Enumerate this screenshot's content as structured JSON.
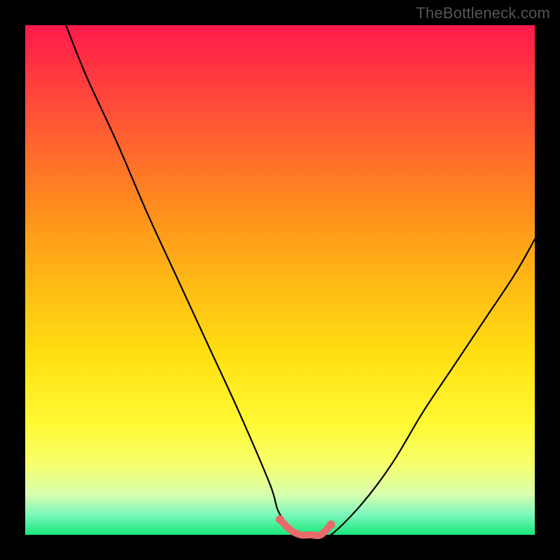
{
  "watermark": "TheBottleneck.com",
  "chart_data": {
    "type": "line",
    "title": "",
    "xlabel": "",
    "ylabel": "",
    "xlim": [
      0,
      100
    ],
    "ylim": [
      0,
      100
    ],
    "grid": false,
    "legend": false,
    "background_gradient": [
      "#ff1a4d",
      "#ffe012",
      "#18e87a"
    ],
    "series": [
      {
        "name": "bottleneck-curve",
        "x": [
          8,
          12,
          18,
          24,
          30,
          36,
          42,
          48,
          50,
          54,
          58,
          60,
          66,
          72,
          78,
          84,
          90,
          96,
          100
        ],
        "y": [
          100,
          90,
          77,
          63,
          50,
          37,
          24,
          10,
          4,
          0,
          0,
          0,
          6,
          14,
          24,
          33,
          42,
          51,
          58
        ]
      },
      {
        "name": "valley-highlight",
        "x": [
          50,
          52,
          54,
          56,
          58,
          60
        ],
        "y": [
          3,
          1,
          0,
          0,
          0,
          2
        ]
      }
    ],
    "annotations": [],
    "colors": {
      "curve": "#000000",
      "highlight": "#e86a6a"
    }
  }
}
